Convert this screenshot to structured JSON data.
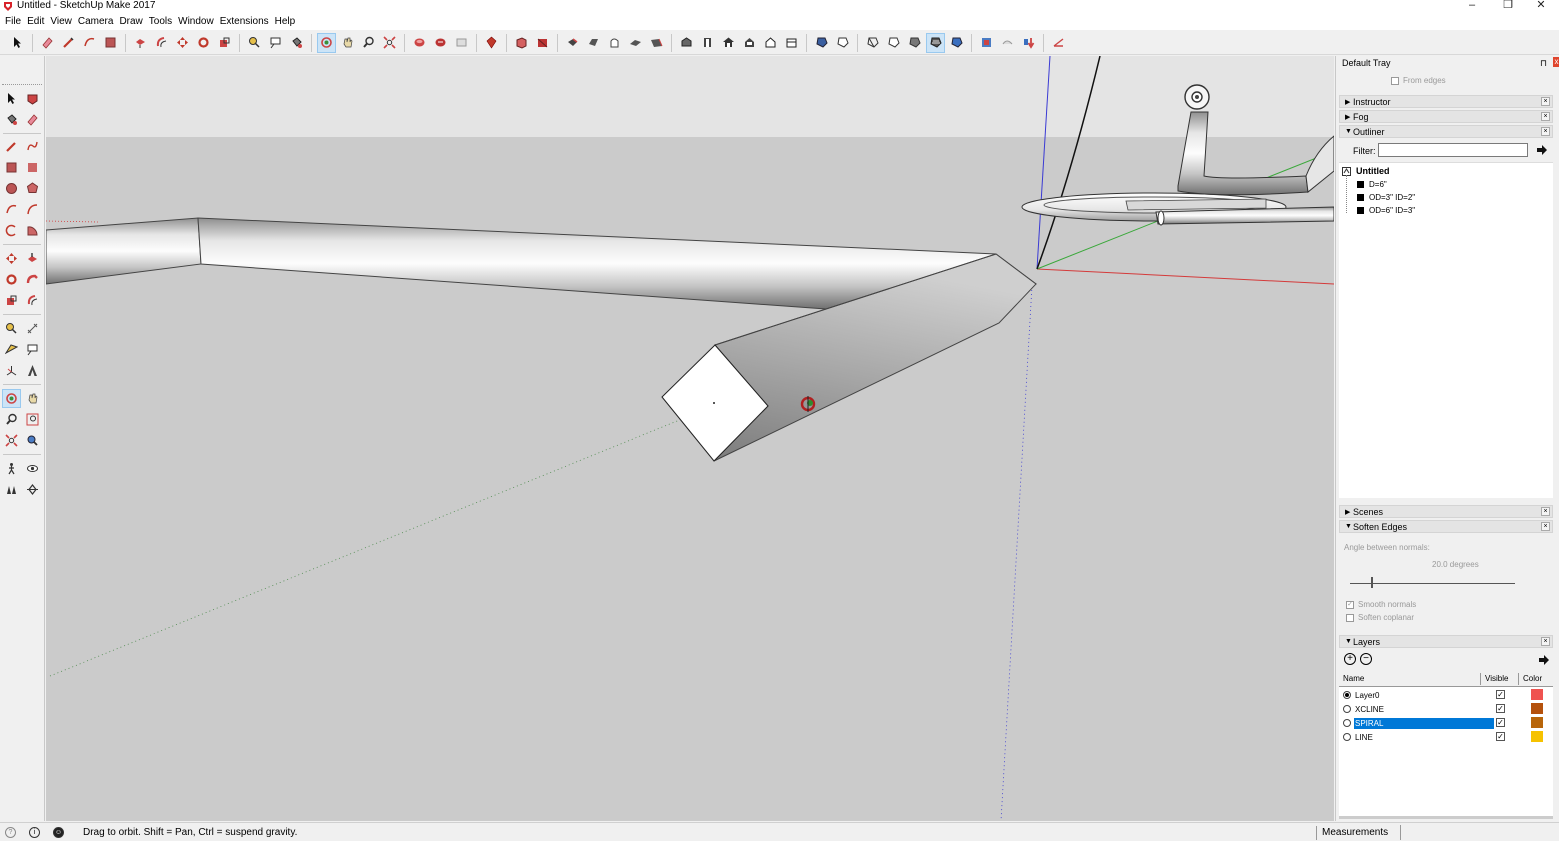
{
  "window": {
    "title": "Untitled - SketchUp Make 2017",
    "minimize": "–",
    "maximize": "❐",
    "close": "✕"
  },
  "menu": [
    "File",
    "Edit",
    "View",
    "Camera",
    "Draw",
    "Tools",
    "Window",
    "Extensions",
    "Help"
  ],
  "tray": {
    "title": "Default Tray",
    "pin": "⊓",
    "close": "x",
    "from_edges_label": "From edges",
    "panels": {
      "instructor": "Instructor",
      "fog": "Fog",
      "outliner": "Outliner",
      "scenes": "Scenes",
      "soften_edges": "Soften Edges",
      "layers": "Layers"
    },
    "panel_close": "×",
    "outliner": {
      "filter_label": "Filter:",
      "filter_value": "",
      "root": "Untitled",
      "items": [
        "D=6\"",
        "OD=3\" ID=2\"",
        "OD=6\" ID=3\""
      ]
    },
    "soften": {
      "angle_label": "Angle between normals:",
      "angle_value": "20.0  degrees",
      "slider_fraction": 0.13,
      "smooth_normals": "Smooth normals",
      "soften_coplanar": "Soften coplanar"
    },
    "layers": {
      "add": "+",
      "remove": "−",
      "col_name": "Name",
      "col_visible": "Visible",
      "col_color": "Color",
      "rows": [
        {
          "name": "Layer0",
          "active": true,
          "visible": true,
          "color": "#ef5350",
          "selected": false
        },
        {
          "name": "XCLINE",
          "active": false,
          "visible": true,
          "color": "#b5510c",
          "selected": false
        },
        {
          "name": "SPIRAL",
          "active": false,
          "visible": true,
          "color": "#b8650a",
          "selected": true
        },
        {
          "name": "LINE",
          "active": false,
          "visible": true,
          "color": "#f6c200",
          "selected": false
        }
      ]
    }
  },
  "status": {
    "hint": "Drag to orbit. Shift = Pan, Ctrl = suspend gravity.",
    "measurements_label": "Measurements",
    "measurements_value": ""
  },
  "colors": {
    "axis_red": "#d43a3a",
    "axis_green": "#3aa83a",
    "axis_blue": "#3a3ad4",
    "selection": "#0078d7",
    "sky": "#e4e4e4",
    "ground": "#cbcbcb"
  },
  "icons": {
    "toolbar": [
      "select-arrow-icon",
      "eraser-icon",
      "line-icon",
      "arc-icon",
      "rectangle-icon",
      "push-pull-icon",
      "offset-icon",
      "move-icon",
      "rotate-icon",
      "scale-icon",
      "tape-measure-icon",
      "text-icon",
      "paint-bucket-icon",
      "orbit-icon",
      "pan-icon",
      "zoom-icon",
      "zoom-extents-icon",
      "warehouse-icon",
      "extension-warehouse-icon",
      "layout-icon",
      "ruby-icon",
      "box-icon",
      "cone-icon",
      "solid-union-icon",
      "solid-subtract-icon",
      "solid-trim-icon",
      "solid-split-icon",
      "iso-view-icon",
      "top-view-icon",
      "front-view-icon",
      "right-view-icon",
      "back-view-icon",
      "left-view-icon",
      "xray-icon",
      "wireframe-icon",
      "hidden-line-icon",
      "shaded-icon",
      "shaded-textures-icon",
      "monochrome-icon",
      "section-plane-icon",
      "section-display-icon",
      "section-fill-icon",
      "sandbox-icon"
    ]
  }
}
